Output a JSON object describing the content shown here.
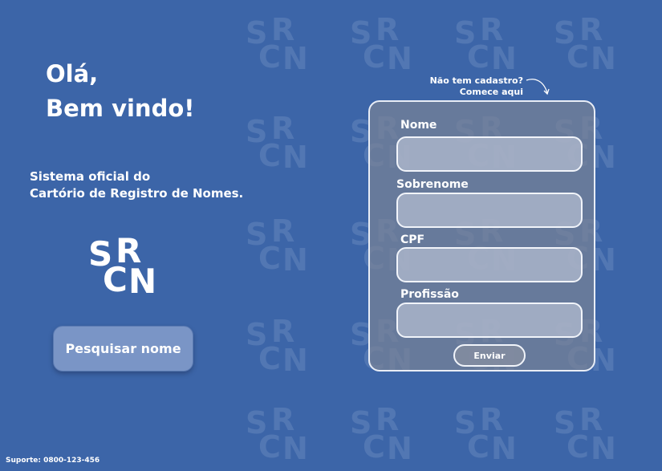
{
  "greeting": {
    "line1": "Olá,",
    "line2": "Bem vindo!"
  },
  "subtitle": {
    "line1": "Sistema oficial do",
    "line2": "Cartório de Registro de Nomes."
  },
  "logo": {
    "letters": [
      "S",
      "R",
      "C",
      "N"
    ]
  },
  "search_button": {
    "label": "Pesquisar nome"
  },
  "signup_hint": {
    "line1": "Não tem cadastro?",
    "line2": "Comece aqui"
  },
  "form": {
    "fields": [
      {
        "label": "Nome",
        "value": ""
      },
      {
        "label": "Sobrenome",
        "value": ""
      },
      {
        "label": "CPF",
        "value": ""
      },
      {
        "label": "Profissão",
        "value": ""
      }
    ],
    "submit_label": "Enviar"
  },
  "footer": {
    "support": "Suporte: 0800-123-456"
  },
  "colors": {
    "background": "#3c65a8",
    "button": "#7a95c6",
    "card": "#787f95"
  }
}
